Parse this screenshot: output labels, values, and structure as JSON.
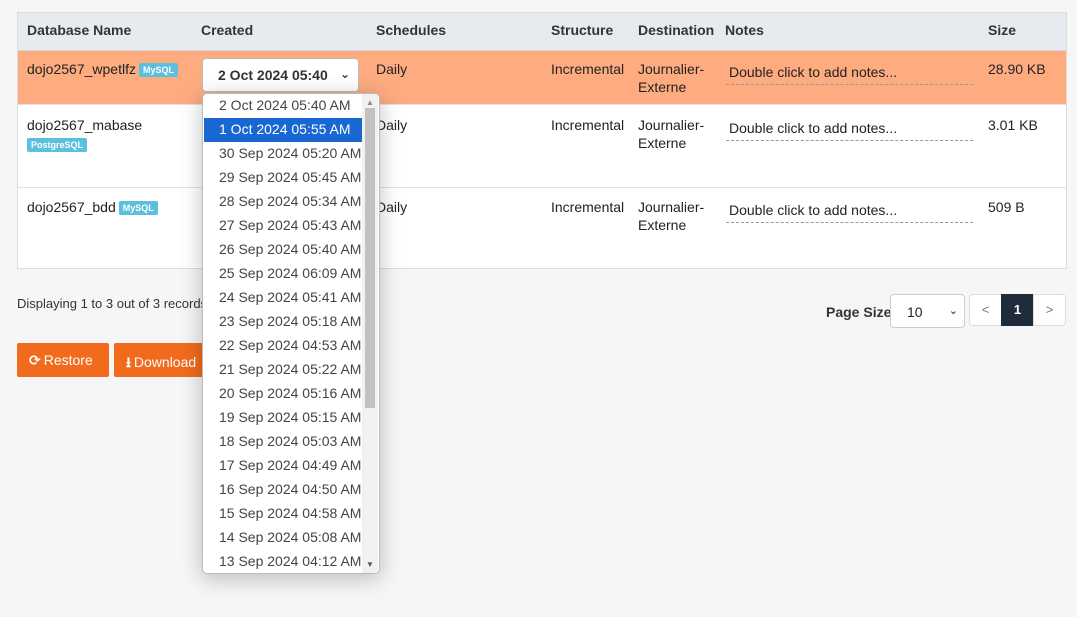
{
  "table": {
    "headers": {
      "database_name": "Database Name",
      "created": "Created",
      "schedules": "Schedules",
      "structure": "Structure",
      "destination": "Destination",
      "notes": "Notes",
      "size": "Size"
    },
    "rows": [
      {
        "name": "dojo2567_wpetlfz",
        "db_type": "MySQL",
        "created": "2 Oct 2024 05:40",
        "schedule": "Daily",
        "structure": "Incremental",
        "destination_line1": "Journalier-",
        "destination_line2": "Externe",
        "notes": "Double click to add notes...",
        "size": "28.90 KB"
      },
      {
        "name": "dojo2567_mabase",
        "db_type": "PostgreSQL",
        "schedule": "Daily",
        "structure": "Incremental",
        "destination_line1": "Journalier-",
        "destination_line2": "Externe",
        "notes": "Double click to add notes...",
        "size": "3.01 KB"
      },
      {
        "name": "dojo2567_bdd",
        "db_type": "MySQL",
        "schedule": "Daily",
        "structure": "Incremental",
        "destination_line1": "Journalier-",
        "destination_line2": "Externe",
        "notes": "Double click to add notes...",
        "size": "509 B"
      }
    ]
  },
  "status_text": "Displaying 1 to 3 out of 3 records",
  "pagination": {
    "page_size_label": "Page Size",
    "page_size_value": "10",
    "prev": "<",
    "current_page": "1",
    "next": ">"
  },
  "actions": {
    "restore": "Restore",
    "download": "Download"
  },
  "dropdown": {
    "highlighted_index": 1,
    "options": [
      "2 Oct 2024 05:40 AM",
      "1 Oct 2024 05:55 AM",
      "30 Sep 2024 05:20 AM",
      "29 Sep 2024 05:45 AM",
      "28 Sep 2024 05:34 AM",
      "27 Sep 2024 05:43 AM",
      "26 Sep 2024 05:40 AM",
      "25 Sep 2024 06:09 AM",
      "24 Sep 2024 05:41 AM",
      "23 Sep 2024 05:18 AM",
      "22 Sep 2024 04:53 AM",
      "21 Sep 2024 05:22 AM",
      "20 Sep 2024 05:16 AM",
      "19 Sep 2024 05:15 AM",
      "18 Sep 2024 05:03 AM",
      "17 Sep 2024 04:49 AM",
      "16 Sep 2024 04:50 AM",
      "15 Sep 2024 04:58 AM",
      "14 Sep 2024 05:08 AM",
      "13 Sep 2024 04:12 AM"
    ]
  },
  "colors": {
    "selected_row": "#ffab80",
    "accent_button": "#f26b1d",
    "badge": "#5bc0de",
    "dropdown_highlight": "#1967d2",
    "active_page": "#1f2d3a"
  }
}
